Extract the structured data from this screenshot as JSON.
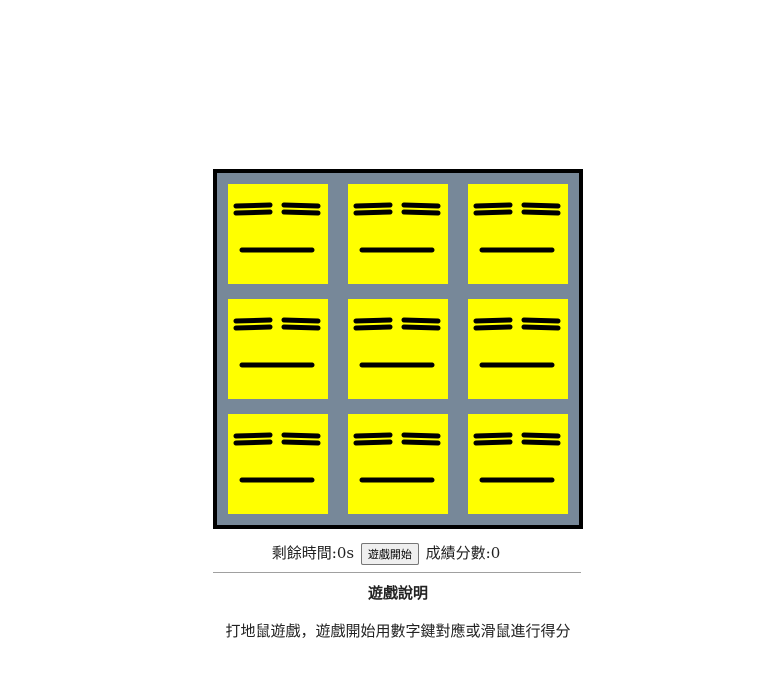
{
  "game": {
    "board_color": "#778899",
    "hole_color": "#ffff00",
    "border_color": "#000000",
    "holes": [
      {
        "key": "1",
        "state": "hidden",
        "face": "closed-eyes-face-icon"
      },
      {
        "key": "2",
        "state": "hidden",
        "face": "closed-eyes-face-icon"
      },
      {
        "key": "3",
        "state": "hidden",
        "face": "closed-eyes-face-icon"
      },
      {
        "key": "4",
        "state": "hidden",
        "face": "closed-eyes-face-icon"
      },
      {
        "key": "5",
        "state": "hidden",
        "face": "closed-eyes-face-icon"
      },
      {
        "key": "6",
        "state": "hidden",
        "face": "closed-eyes-face-icon"
      },
      {
        "key": "7",
        "state": "hidden",
        "face": "closed-eyes-face-icon"
      },
      {
        "key": "8",
        "state": "hidden",
        "face": "closed-eyes-face-icon"
      },
      {
        "key": "9",
        "state": "hidden",
        "face": "closed-eyes-face-icon"
      }
    ]
  },
  "controls": {
    "time_label": "剩餘時間:",
    "time_value": "0s",
    "start_button": "遊戲開始",
    "score_label": "成績分數:",
    "score_value": "0"
  },
  "instructions": {
    "title": "遊戲說明",
    "text": "打地鼠遊戲，遊戲開始用數字鍵對應或滑鼠進行得分"
  }
}
